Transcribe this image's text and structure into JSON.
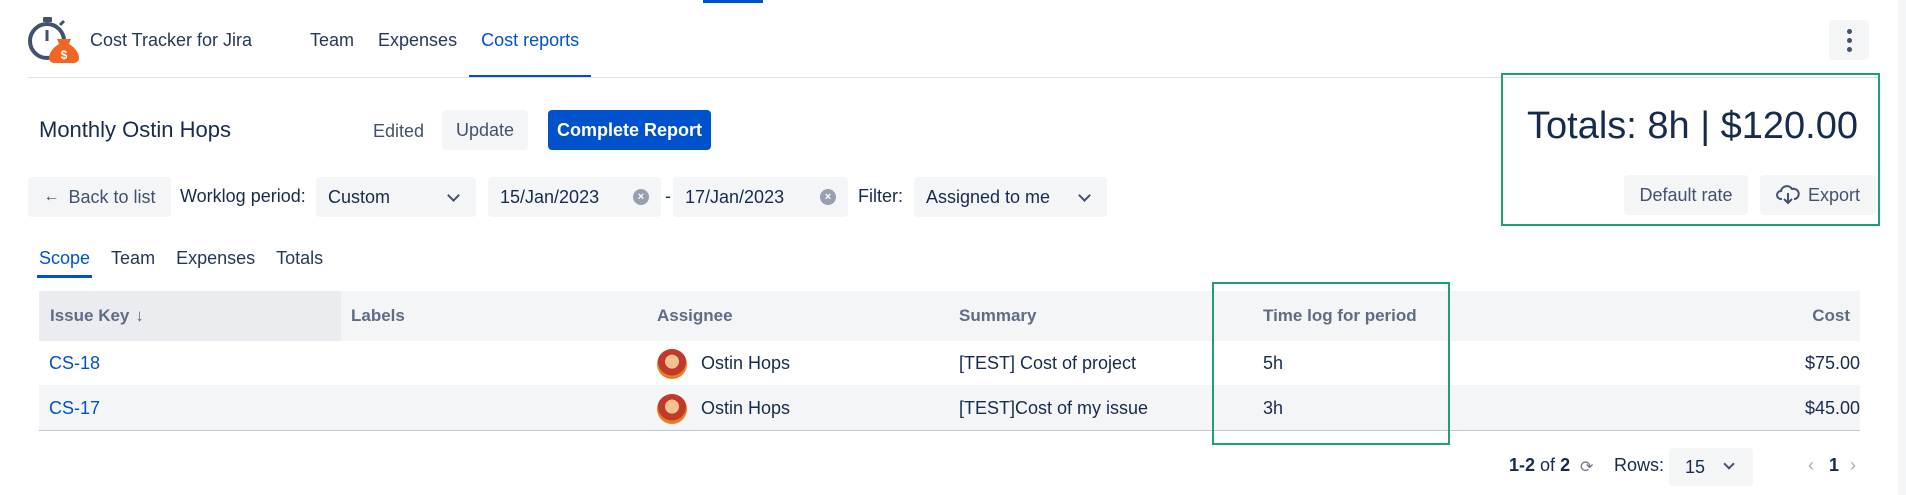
{
  "app": {
    "title": "Cost Tracker for Jira"
  },
  "nav": {
    "items": [
      {
        "label": "Team"
      },
      {
        "label": "Expenses"
      },
      {
        "label": "Cost reports"
      }
    ],
    "active": "Cost reports"
  },
  "report": {
    "title": "Monthly Ostin Hops",
    "status": "Edited",
    "update_label": "Update",
    "complete_label": "Complete Report",
    "totals": "Totals: 8h | $120.00",
    "default_rate_label": "Default rate",
    "export_label": "Export"
  },
  "filters": {
    "back_label": "Back to list",
    "worklog_label": "Worklog period:",
    "period_value": "Custom",
    "date_start": "15/Jan/2023",
    "date_separator": "-",
    "date_end": "17/Jan/2023",
    "filter_label": "Filter:",
    "filter_value": "Assigned to me"
  },
  "subtabs": [
    {
      "label": "Scope"
    },
    {
      "label": "Team"
    },
    {
      "label": "Expenses"
    },
    {
      "label": "Totals"
    }
  ],
  "table": {
    "columns": [
      "Issue Key",
      "Labels",
      "Assignee",
      "Summary",
      "Time log for period",
      "Cost"
    ],
    "sort_icon": "↓",
    "rows": [
      {
        "key": "CS-18",
        "labels": "",
        "assignee": "Ostin Hops",
        "summary": "[TEST] Cost of project",
        "time": "5h",
        "cost": "$75.00"
      },
      {
        "key": "CS-17",
        "labels": "",
        "assignee": "Ostin Hops",
        "summary": "[TEST]Cost of my issue",
        "time": "3h",
        "cost": "$45.00"
      }
    ]
  },
  "pagination": {
    "range": "1-2",
    "of_label": "of",
    "total": "2",
    "rows_label": "Rows:",
    "rows_value": "15",
    "current_page": "1"
  },
  "colors": {
    "accent": "#0052cc",
    "highlight": "#1f9f75",
    "logo_orange": "#f26522",
    "logo_blue": "#42526e"
  },
  "icons": [
    "stopwatch-money-logo-icon",
    "kebab-menu-icon",
    "arrow-left-icon",
    "chevron-down-icon",
    "clear-icon",
    "cloud-download-icon",
    "sort-arrow-icon",
    "refresh-icon",
    "chevron-left-icon",
    "chevron-right-icon"
  ]
}
